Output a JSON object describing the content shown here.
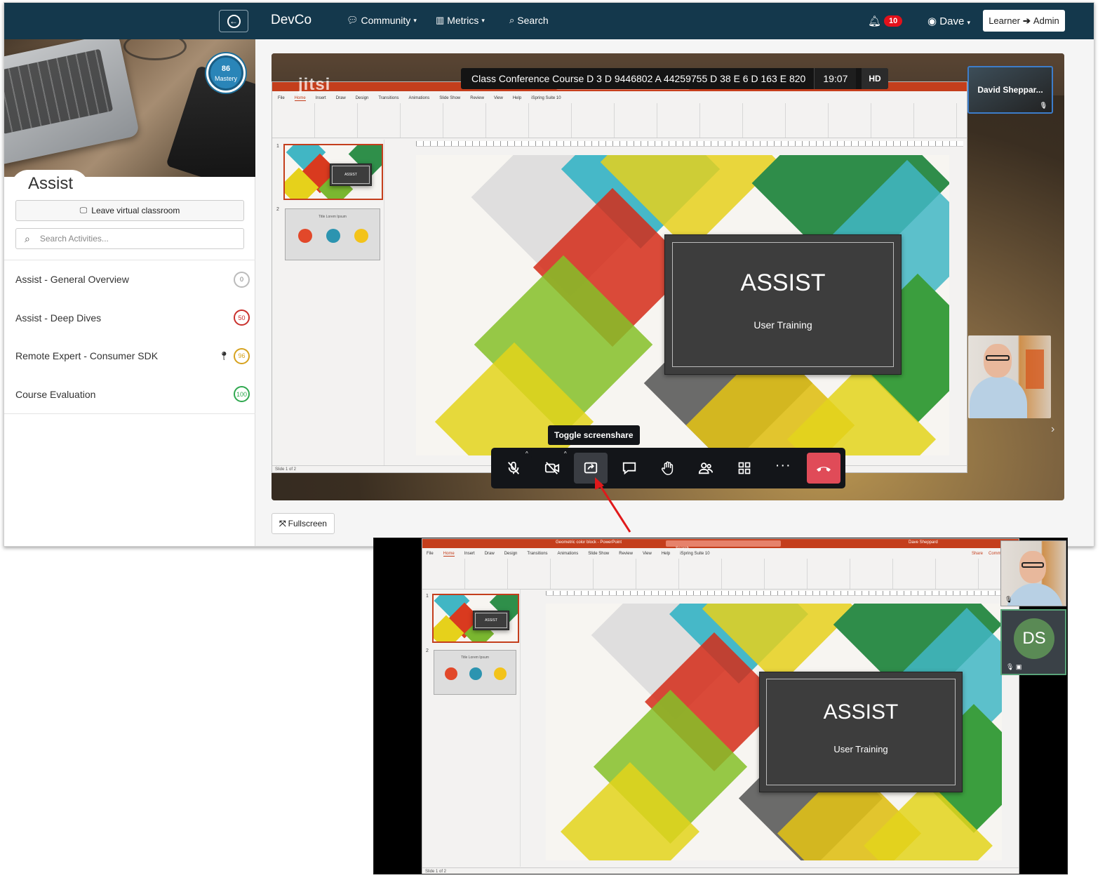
{
  "nav": {
    "brand": "DevCo",
    "community": "Community",
    "metrics": "Metrics",
    "search": "Search",
    "notifications": "10",
    "user": "Dave",
    "role_from": "Learner",
    "role_to": "Admin"
  },
  "sidebar": {
    "mastery_value": "86",
    "mastery_label": "Mastery",
    "course_title": "Assist",
    "leave_label": "Leave virtual classroom",
    "search_placeholder": "Search Activities...",
    "activities": [
      {
        "label": "Assist - General Overview",
        "score": "0",
        "color": "#bbbbbb"
      },
      {
        "label": "Assist - Deep Dives",
        "score": "50",
        "color": "#c9302c"
      },
      {
        "label": "Remote Expert - Consumer SDK",
        "score": "96",
        "color": "#d6a21e"
      },
      {
        "label": "Course Evaluation",
        "score": "100",
        "color": "#2fa84f"
      }
    ]
  },
  "meeting": {
    "logo": "jitsi",
    "title": "Class Conference Course D 3 D 9446802 A 44259755 D 38 E 6 D 163 E 820",
    "time": "19:07",
    "quality": "HD",
    "remote_name": "David Sheppar...",
    "tooltip": "Toggle screenshare",
    "fullscreen_label": "Fullscreen"
  },
  "ppt": {
    "menu": [
      "File",
      "Home",
      "Insert",
      "Draw",
      "Design",
      "Transitions",
      "Animations",
      "Slide Show",
      "Review",
      "View",
      "Help",
      "iSpring Suite 10"
    ],
    "doc_title": "Geometric color block - PowerPoint",
    "search": "Search",
    "user": "Dave Sheppard",
    "share": "Share",
    "comments": "Comments",
    "slide_title": "ASSIST",
    "slide_subtitle": "User Training",
    "thumb2_title": "Title Lorem Ipsum",
    "status": "Slide 1 of 2"
  },
  "bottom": {
    "avatar_initials": "DS"
  },
  "colors": {
    "nav_bg": "#14384c",
    "hangup": "#e04b58",
    "ppt_red": "#c43e1c",
    "arrow": "#e0191b"
  }
}
